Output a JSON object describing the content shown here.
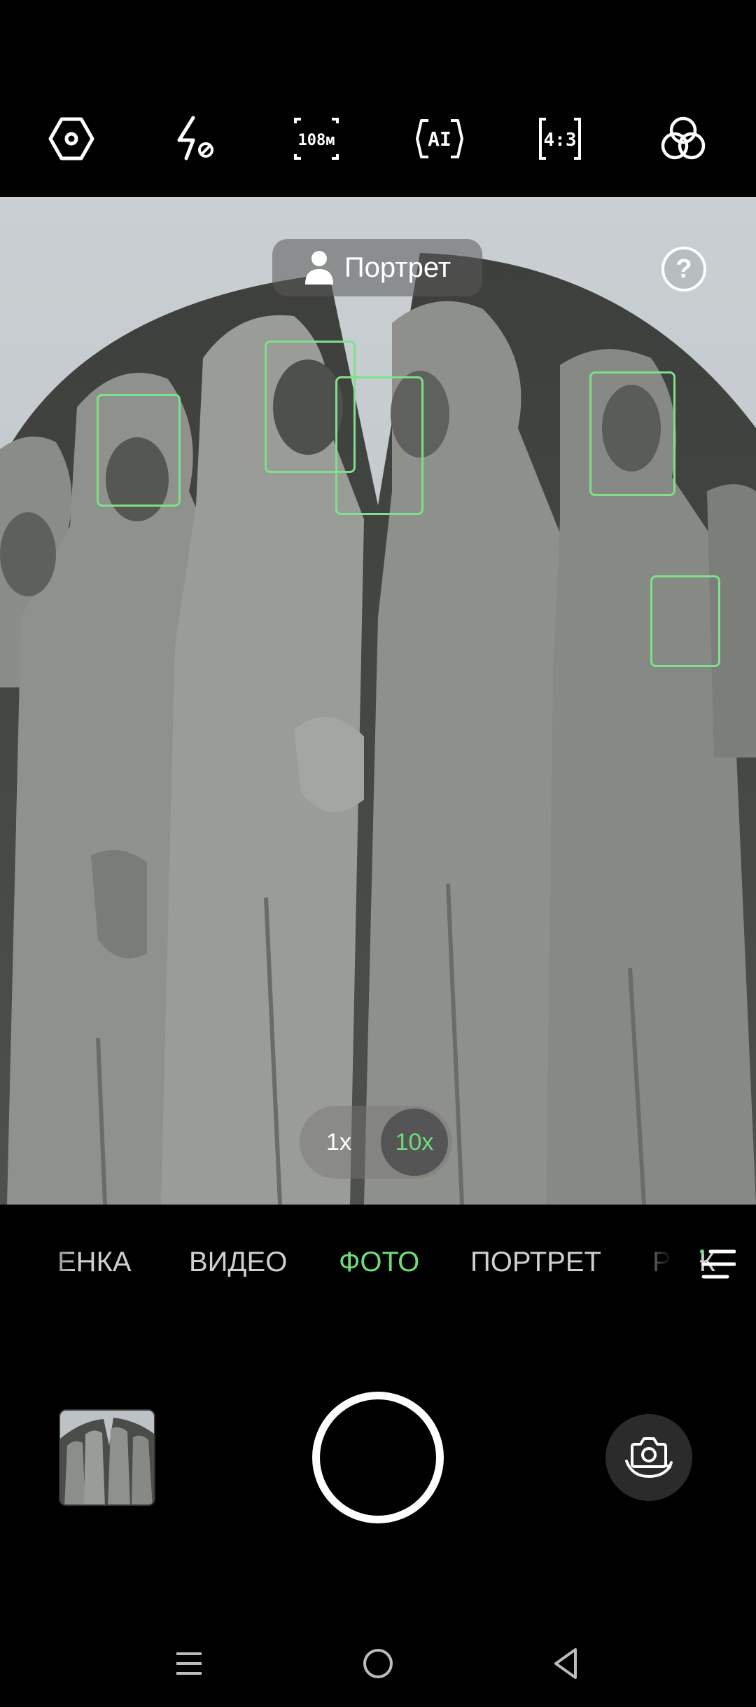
{
  "toolbar": {
    "items": [
      {
        "name": "settings-icon",
        "label": ""
      },
      {
        "name": "flash-off-icon",
        "label": ""
      },
      {
        "name": "resolution-108m-icon",
        "label": "108м"
      },
      {
        "name": "ai-scene-icon",
        "label": "AI"
      },
      {
        "name": "aspect-ratio-icon",
        "label": "4:3"
      },
      {
        "name": "filters-icon",
        "label": ""
      }
    ]
  },
  "viewfinder": {
    "mode_chip": {
      "icon": "person-icon",
      "label": "Портрет"
    },
    "help_label": "?",
    "face_boxes_count": 5
  },
  "zoom": {
    "options": [
      "1x",
      "10x"
    ],
    "selected": "10x"
  },
  "modes": {
    "items": [
      "ЕНКА",
      "ВИДЕО",
      "ФОТО",
      "ПОРТРЕТ",
      "РЕЖ"
    ],
    "selected": "ФОТО"
  },
  "colors": {
    "accent": "#6fdc7c",
    "face_box": "#7ee08a",
    "background": "#000000"
  },
  "nav": {
    "items": [
      "menu-icon",
      "home-icon",
      "back-icon"
    ]
  }
}
